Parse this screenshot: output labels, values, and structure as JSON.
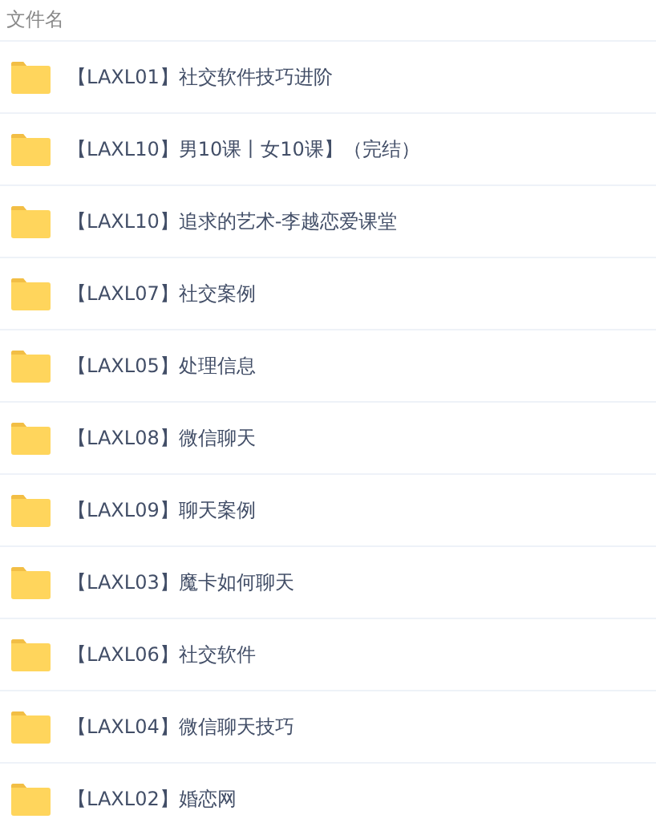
{
  "header": {
    "column_1": "文件名"
  },
  "files": [
    {
      "name": "【LAXL01】社交软件技巧进阶"
    },
    {
      "name": "【LAXL10】男10课丨女10课】（完结）"
    },
    {
      "name": "【LAXL10】追求的艺术-李越恋爱课堂"
    },
    {
      "name": "【LAXL07】社交案例"
    },
    {
      "name": "【LAXL05】处理信息"
    },
    {
      "name": "【LAXL08】微信聊天"
    },
    {
      "name": "【LAXL09】聊天案例"
    },
    {
      "name": "【LAXL03】魔卡如何聊天"
    },
    {
      "name": "【LAXL06】社交软件"
    },
    {
      "name": "【LAXL04】微信聊天技巧"
    },
    {
      "name": "【LAXL02】婚恋网"
    }
  ]
}
